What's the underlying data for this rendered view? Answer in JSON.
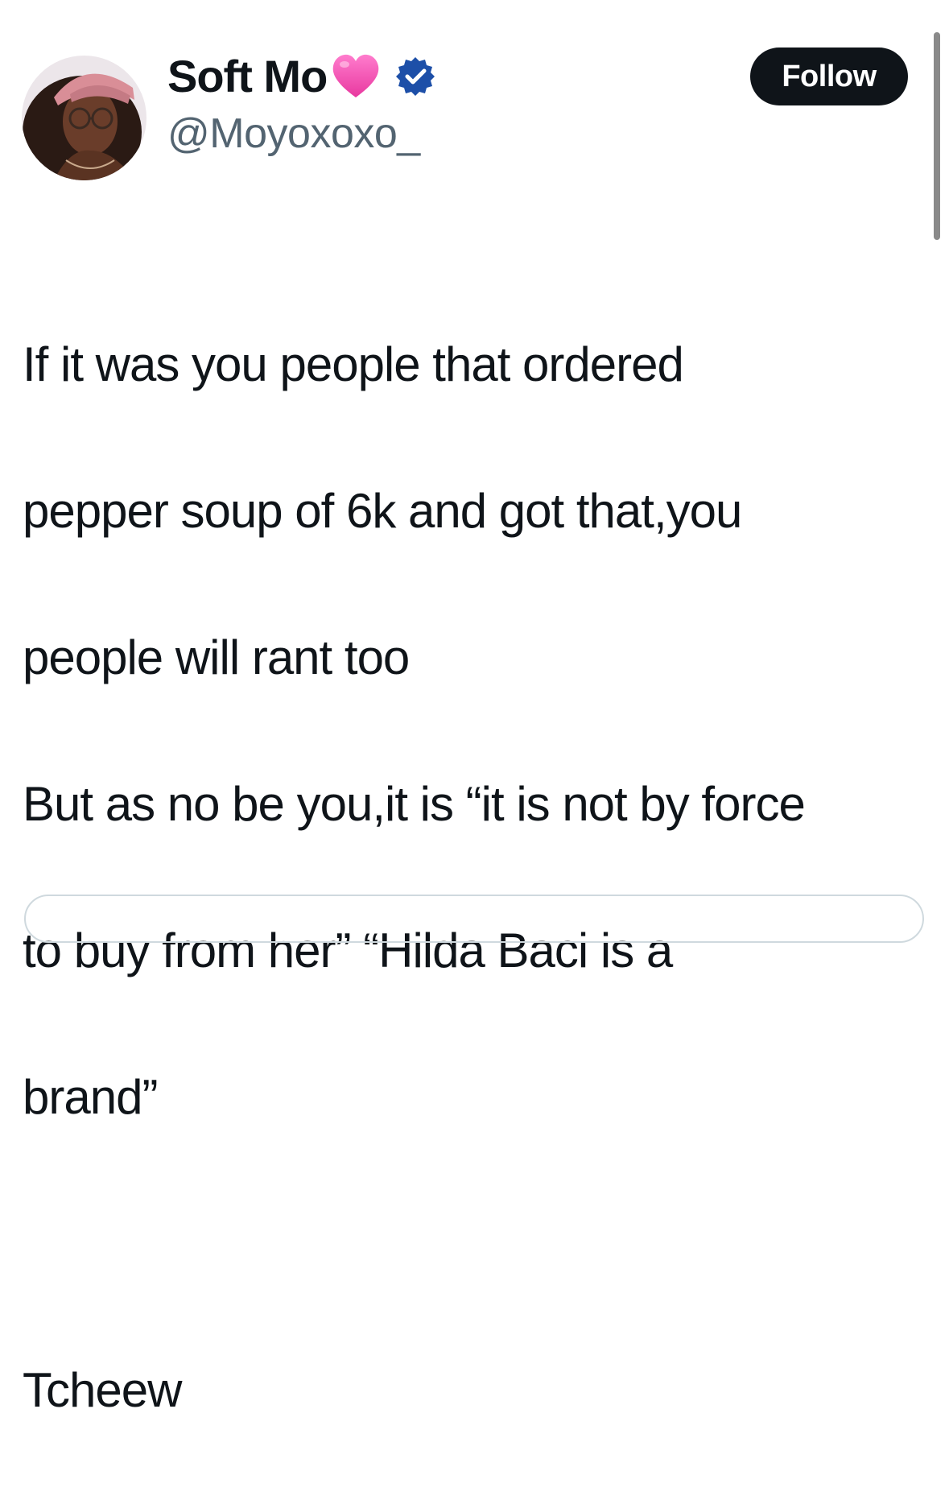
{
  "tweet": {
    "author": {
      "display_name": "Soft Mo",
      "emoji_icon": "pink-heart-icon",
      "verified_icon": "verified-badge-icon",
      "handle": "@Moyoxoxo_",
      "avatar_icon": "profile-photo-avatar"
    },
    "follow_label": "Follow",
    "text_lines": [
      "If it was you people that ordered",
      "pepper soup of 6k and got that,you",
      "people will rant too",
      "But as no be you,it is “it is not by force",
      "to buy from her” “Hilda Baci is a",
      "brand”",
      "",
      "Tcheew"
    ]
  },
  "colors": {
    "text_primary": "#0f1419",
    "text_secondary": "#536471",
    "follow_bg": "#0f1419",
    "verified_blue": "#1d4fa8",
    "heart_pink": "#f25ab8"
  }
}
